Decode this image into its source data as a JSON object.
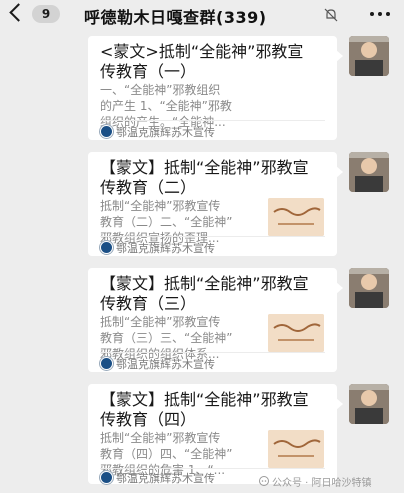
{
  "header": {
    "back_count": "9",
    "title": "呼德勒木日嘎查群(339)",
    "icons": {
      "back": "chevron-left-icon",
      "mute": "bell-muted-icon",
      "more": "more-dots-icon"
    }
  },
  "messages": [
    {
      "title": "<蒙文>抵制“全能神”邪教宣传教育（一）",
      "desc": [
        "一、“全能神”邪教组织",
        "的产生 1、“全能神”邪教",
        "组织的产生。“全能神..."
      ],
      "has_thumbnail": false,
      "source": "鄂温克旗辉苏木宣传"
    },
    {
      "title": "【蒙文】抵制“全能神”邪教宣传教育（二）",
      "desc": [
        "抵制“全能神”邪教宣传",
        "教育（二）二、“全能神”",
        "邪教组织宣扬的歪理..."
      ],
      "has_thumbnail": true,
      "source": "鄂温克旗辉苏木宣传"
    },
    {
      "title": "【蒙文】抵制“全能神”邪教宣传教育（三）",
      "desc": [
        "抵制“全能神”邪教宣传",
        "教育（三）三、“全能神”",
        "邪教组织的组织体系..."
      ],
      "has_thumbnail": true,
      "source": "鄂温克旗辉苏木宣传"
    },
    {
      "title": "【蒙文】抵制“全能神”邪教宣传教育（四）",
      "desc": [
        "抵制“全能神”邪教宣传",
        "教育（四）四、“全能神”",
        "邪教组织的危害 1、“..."
      ],
      "has_thumbnail": true,
      "source": "鄂温克旗辉苏木宣传"
    }
  ],
  "watermark": "公众号 · 阿日哈沙特镇",
  "colors": {
    "background": "#ededed",
    "card": "#ffffff",
    "title": "#191919",
    "desc": "#8a8a8a",
    "source_icon": "#1a4f86"
  }
}
